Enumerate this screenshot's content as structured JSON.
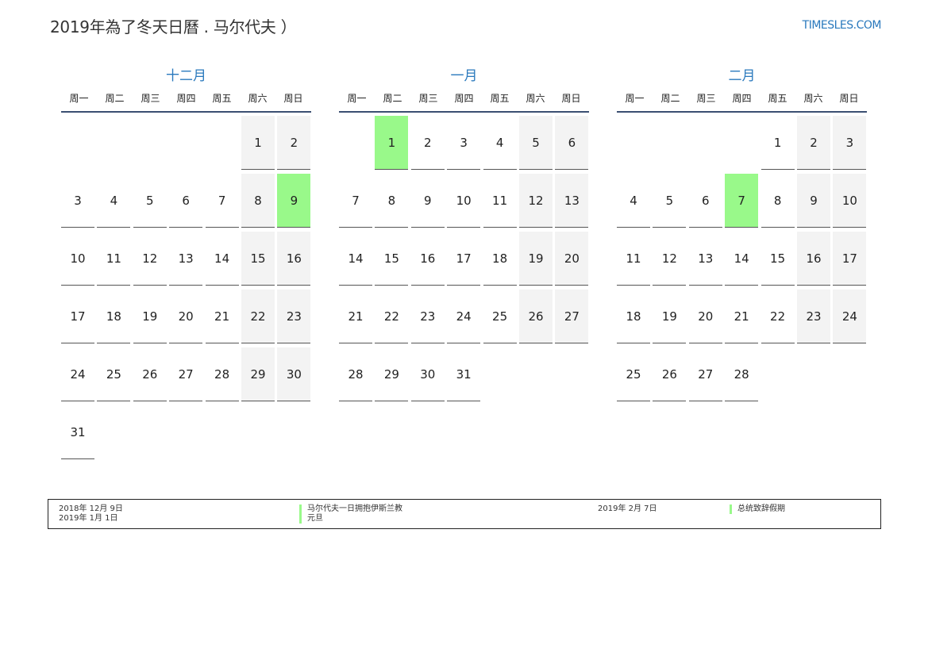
{
  "header": {
    "title": "2019年為了冬天日曆 . 马尔代夫 ）",
    "site": "TIMESLES.COM"
  },
  "weekdays": [
    "周一",
    "周二",
    "周三",
    "周四",
    "周五",
    "周六",
    "周日"
  ],
  "colors": {
    "accent": "#2a79bd",
    "holiday": "#99f98a",
    "weekend": "#f3f3f3",
    "rule": "#3b4f72"
  },
  "months": [
    {
      "name": "十二月",
      "first_weekday": 5,
      "days": 31,
      "holidays": [
        9
      ]
    },
    {
      "name": "一月",
      "first_weekday": 1,
      "days": 31,
      "holidays": [
        1
      ]
    },
    {
      "name": "二月",
      "first_weekday": 4,
      "days": 28,
      "holidays": [
        7
      ]
    }
  ],
  "legend": {
    "left_dates": [
      "2018年 12月 9日",
      "2019年 1月 1日"
    ],
    "left_names": [
      "马尔代夫一日拥抱伊斯兰教",
      "元旦"
    ],
    "right_dates": [
      "2019年 2月 7日"
    ],
    "right_names": [
      "总统致辞假期"
    ]
  }
}
